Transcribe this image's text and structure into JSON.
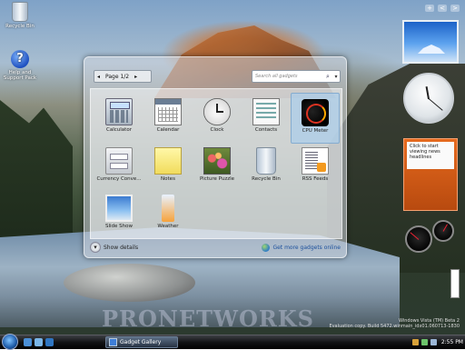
{
  "desktop": {
    "icons": [
      {
        "label": "Recycle Bin"
      },
      {
        "label": "Help and Support Pack"
      }
    ],
    "watermark": "PRONETWORKS",
    "eval_text": {
      "line1": "Windows Vista (TM) Beta 2",
      "line2": "Evaluation copy. Build 5472.winmain_idx01.060713-1830"
    }
  },
  "sidebar": {
    "top_buttons": [
      "+",
      "<",
      ">"
    ],
    "headlines_text": "Click to start viewing news headlines"
  },
  "gallery": {
    "pager_label": "Page 1/2",
    "search_placeholder": "Search all gadgets",
    "gadgets": [
      {
        "label": "Calculator",
        "icon": "calculator-icon"
      },
      {
        "label": "Calendar",
        "icon": "calendar-icon"
      },
      {
        "label": "Clock",
        "icon": "clock-icon"
      },
      {
        "label": "Contacts",
        "icon": "contacts-icon"
      },
      {
        "label": "CPU Meter",
        "icon": "cpu-meter-icon",
        "selected": true
      },
      {
        "label": "Currency Conve...",
        "icon": "currency-icon"
      },
      {
        "label": "Notes",
        "icon": "notes-icon"
      },
      {
        "label": "Picture Puzzle",
        "icon": "picture-puzzle-icon"
      },
      {
        "label": "Recycle Bin",
        "icon": "recycle-bin-icon"
      },
      {
        "label": "RSS Feeds",
        "icon": "rss-feeds-icon"
      },
      {
        "label": "Slide Show",
        "icon": "slide-show-icon"
      },
      {
        "label": "Weather",
        "icon": "weather-icon"
      }
    ],
    "show_details_label": "Show details",
    "get_more_label": "Get more gadgets online"
  },
  "taskbar": {
    "open_window": "Gadget Gallery",
    "time": "2:55 PM"
  },
  "colors": {
    "taskbar": "#121315",
    "selection": "#aacdeb",
    "headline_orange": "#e66a1e"
  }
}
